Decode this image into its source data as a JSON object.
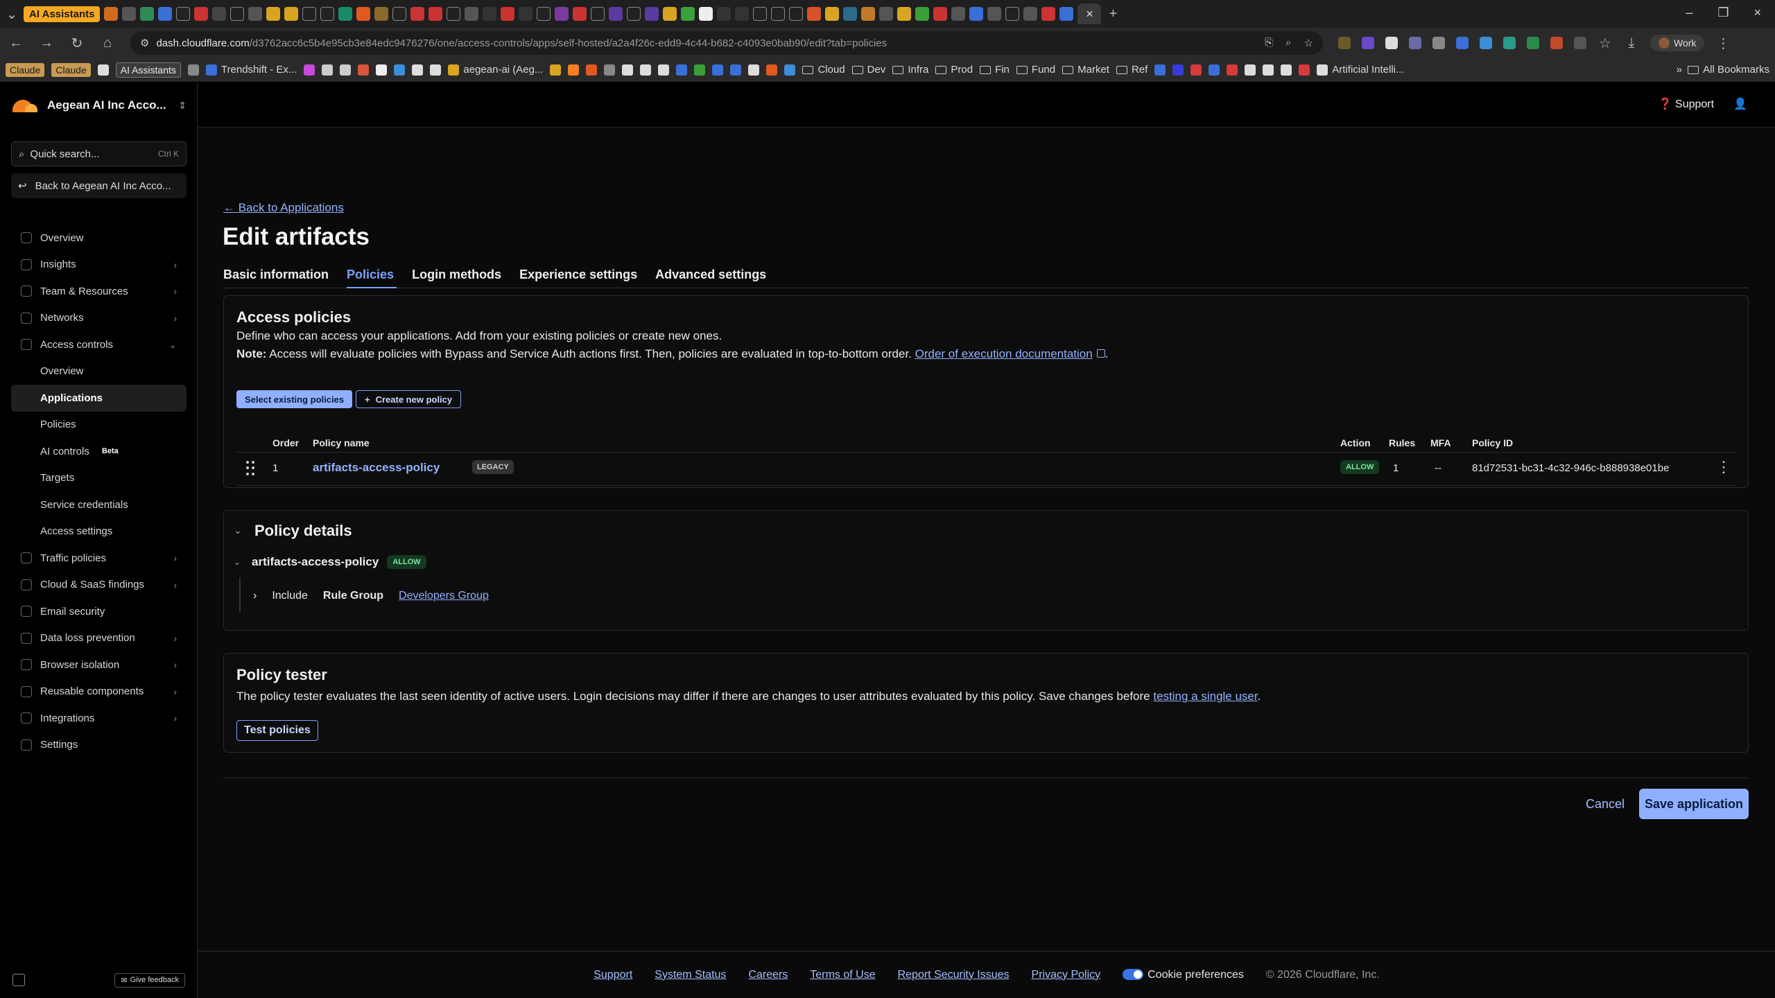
{
  "browser": {
    "active_tab_pill": "AI Assistants",
    "url_host": "dash.cloudflare.com",
    "url_path": "/d3762acc6c5b4e95cb3e84edc9476276/one/access-controls/apps/self-hosted/a2a4f26c-edd9-4c44-b682-c4093e0bab90/edit?tab=policies",
    "profile": "Work",
    "bookmarks": [
      "Claude",
      "Claude",
      "AI Assistants",
      "Trendshift - Ex...",
      "aegean-ai (Aeg...",
      "Cloud",
      "Dev",
      "Infra",
      "Prod",
      "Fin",
      "Fund",
      "Market",
      "Ref",
      "Artificial Intelli..."
    ],
    "all_bookmarks": "All Bookmarks"
  },
  "header": {
    "account": "Aegean AI Inc Acco...",
    "support": "Support"
  },
  "sidebar": {
    "search_placeholder": "Quick search...",
    "search_shortcut": "Ctrl K",
    "back": "Back to Aegean AI Inc Acco...",
    "items": [
      {
        "label": "Overview",
        "chevron": false
      },
      {
        "label": "Insights",
        "chevron": true
      },
      {
        "label": "Team & Resources",
        "chevron": true
      },
      {
        "label": "Networks",
        "chevron": true
      },
      {
        "label": "Access controls",
        "chevron": "down"
      }
    ],
    "sub_items": [
      {
        "label": "Overview"
      },
      {
        "label": "Applications",
        "active": true
      },
      {
        "label": "Policies"
      },
      {
        "label": "AI controls",
        "badge": "Beta"
      },
      {
        "label": "Targets"
      },
      {
        "label": "Service credentials"
      },
      {
        "label": "Access settings"
      }
    ],
    "items2": [
      {
        "label": "Traffic policies",
        "chevron": true
      },
      {
        "label": "Cloud & SaaS findings",
        "chevron": true
      },
      {
        "label": "Email security",
        "chevron": false
      },
      {
        "label": "Data loss prevention",
        "chevron": true
      },
      {
        "label": "Browser isolation",
        "chevron": true
      },
      {
        "label": "Reusable components",
        "chevron": true
      },
      {
        "label": "Integrations",
        "chevron": true
      },
      {
        "label": "Settings",
        "chevron": false
      }
    ],
    "feedback": "Give feedback"
  },
  "page": {
    "back_link": "← Back to Applications",
    "title": "Edit artifacts",
    "tabs": [
      "Basic information",
      "Policies",
      "Login methods",
      "Experience settings",
      "Advanced settings"
    ],
    "active_tab": "Policies"
  },
  "access_policies": {
    "title": "Access policies",
    "desc": "Define who can access your applications. Add from your existing policies or create new ones.",
    "note_label": "Note:",
    "note_text": " Access will evaluate policies with Bypass and Service Auth actions first. Then, policies are evaluated in top-to-bottom order. ",
    "note_link": "Order of execution documentation",
    "note_end": ".",
    "btn_select": "Select existing policies",
    "btn_create": "Create new policy",
    "columns": {
      "order": "Order",
      "name": "Policy name",
      "action": "Action",
      "rules": "Rules",
      "mfa": "MFA",
      "id": "Policy ID"
    },
    "rows": [
      {
        "order": "1",
        "name": "artifacts-access-policy",
        "tag": "LEGACY",
        "action": "ALLOW",
        "rules": "1",
        "mfa": "--",
        "id": "81d72531-bc31-4c32-946c-b888938e01be"
      }
    ]
  },
  "policy_details": {
    "title": "Policy details",
    "policy": "artifacts-access-policy",
    "action": "ALLOW",
    "include": "Include",
    "rule_type": "Rule Group",
    "rule_value": "Developers Group"
  },
  "policy_tester": {
    "title": "Policy tester",
    "desc": "The policy tester evaluates the last seen identity of active users. Login decisions may differ if there are changes to user attributes evaluated by this policy. Save changes before ",
    "link": "testing a single user",
    "end": ".",
    "button": "Test policies"
  },
  "actions": {
    "cancel": "Cancel",
    "save": "Save application"
  },
  "footer": {
    "links": [
      "Support",
      "System Status",
      "Careers",
      "Terms of Use",
      "Report Security Issues",
      "Privacy Policy"
    ],
    "cookie": "Cookie preferences",
    "copyright": "© 2026 Cloudflare, Inc."
  }
}
